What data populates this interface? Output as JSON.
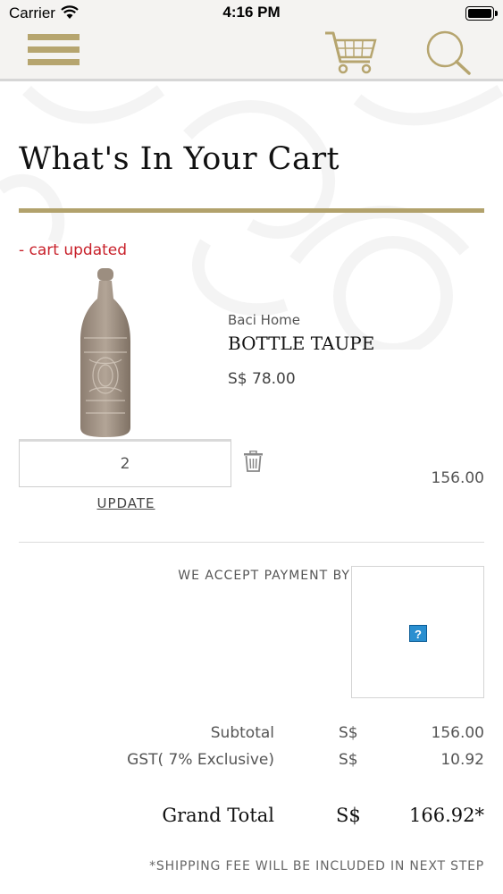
{
  "status_bar": {
    "carrier": "Carrier",
    "time": "4:16 PM"
  },
  "nav": {
    "menu_icon": "hamburger-menu-icon",
    "cart_icon": "shopping-cart-icon",
    "search_icon": "search-icon"
  },
  "colors": {
    "accent": "#b2a26c",
    "error": "#c8202a"
  },
  "page": {
    "title": "What's In Your Cart",
    "message": "- cart updated"
  },
  "item": {
    "brand": "Baci Home",
    "name": "BOTTLE TAUPE",
    "price": "S$ 78.00",
    "quantity": "2",
    "line_total": "156.00",
    "update_label": "UPDATE"
  },
  "payment": {
    "label": "WE ACCEPT PAYMENT BY",
    "missing_image_glyph": "?"
  },
  "summary": {
    "subtotal_label": "Subtotal",
    "subtotal_currency": "S$",
    "subtotal_value": "156.00",
    "gst_label": "GST( 7% Exclusive)",
    "gst_currency": "S$",
    "gst_value": "10.92",
    "grand_total_label": "Grand Total",
    "grand_total_currency": "S$",
    "grand_total_value": "166.92*"
  },
  "footer": {
    "shipping_note": "*SHIPPING FEE WILL BE INCLUDED IN NEXT STEP"
  }
}
